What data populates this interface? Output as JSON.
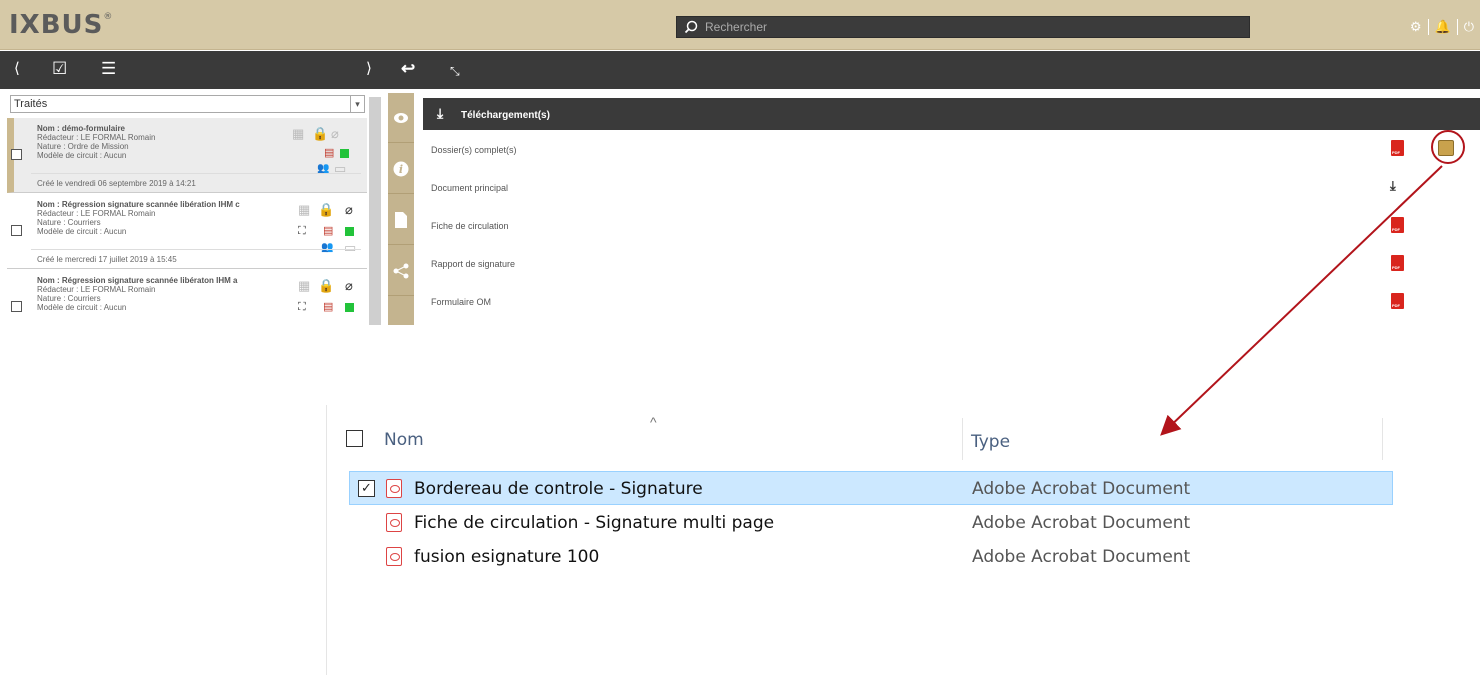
{
  "app": {
    "logo": "IXBUS",
    "logo_mark": "®",
    "search_placeholder": "Rechercher"
  },
  "filter": {
    "selected": "Traités"
  },
  "items": [
    {
      "nom": "Nom : démo-formulaire",
      "redacteur": "Rédacteur : LE FORMAL Romain",
      "nature": "Nature : Ordre de Mission",
      "modele": "Modèle de circuit : Aucun",
      "created": "Créé le vendredi 06 septembre 2019 à 14:21"
    },
    {
      "nom": "Nom : Régression signature scannée libération IHM c",
      "redacteur": "Rédacteur : LE FORMAL Romain",
      "nature": "Nature : Courriers",
      "modele": "Modèle de circuit : Aucun",
      "created": "Créé le mercredi 17 juillet 2019 à 15:45"
    },
    {
      "nom": "Nom : Régression signature scannée libératon IHM a",
      "redacteur": "Rédacteur : LE FORMAL Romain",
      "nature": "Nature : Courriers",
      "modele": "Modèle de circuit : Aucun",
      "created": ""
    }
  ],
  "downloads": {
    "title": "Téléchargement(s)",
    "rows": [
      "Dossier(s) complet(s)",
      "Document principal",
      "Fiche de circulation",
      "Rapport de signature",
      "Formulaire OM"
    ]
  },
  "explorer": {
    "col_name": "Nom",
    "col_type": "Type",
    "files": [
      {
        "name": "Bordereau de controle - Signature",
        "type": "Adobe Acrobat Document",
        "selected": true
      },
      {
        "name": "Fiche de circulation - Signature multi page",
        "type": "Adobe Acrobat Document",
        "selected": false
      },
      {
        "name": "fusion esignature 100",
        "type": "Adobe Acrobat Document",
        "selected": false
      }
    ]
  },
  "colors": {
    "header_bg": "#d6c9a7",
    "toolbar_bg": "#3a3a3a",
    "accent_tab": "#c4b48f",
    "pdf_red": "#d9251d",
    "annotation_red": "#b2141b",
    "selection_bg": "#cce8ff"
  }
}
